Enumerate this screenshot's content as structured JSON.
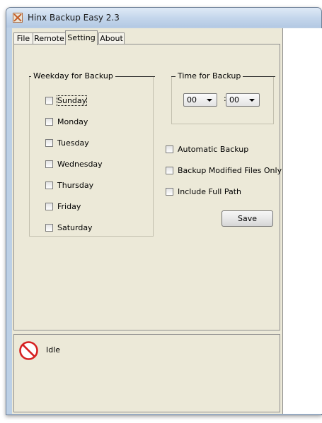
{
  "window": {
    "title": "Hinx Backup Easy 2.3"
  },
  "tabs": [
    {
      "label": "File",
      "active": false
    },
    {
      "label": "Remote",
      "active": false
    },
    {
      "label": "Setting",
      "active": true
    },
    {
      "label": "About",
      "active": false
    }
  ],
  "weekday_group": {
    "title": "Weekday for Backup",
    "days": [
      {
        "label": "Sunday",
        "checked": false
      },
      {
        "label": "Monday",
        "checked": false
      },
      {
        "label": "Tuesday",
        "checked": false
      },
      {
        "label": "Wednesday",
        "checked": false
      },
      {
        "label": "Thursday",
        "checked": false
      },
      {
        "label": "Friday",
        "checked": false
      },
      {
        "label": "Saturday",
        "checked": false
      }
    ]
  },
  "time_group": {
    "title": "Time for Backup",
    "hour": "00",
    "separator": ":",
    "minute": "00"
  },
  "options": [
    {
      "label": "Automatic Backup",
      "checked": false
    },
    {
      "label": "Backup Modified Files Only",
      "checked": false
    },
    {
      "label": "Include Full Path",
      "checked": false
    }
  ],
  "save_label": "Save",
  "status": {
    "icon": "prohibited-icon",
    "text": "Idle",
    "icon_color": "#d62020"
  }
}
